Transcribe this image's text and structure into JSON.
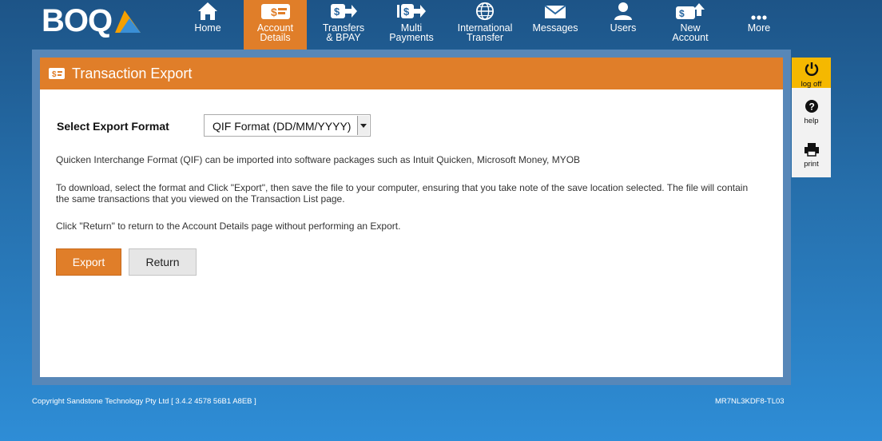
{
  "brand": {
    "logo_text": "BOQ"
  },
  "nav": {
    "items": [
      {
        "line1": "Home",
        "line2": "",
        "icon": "home-icon"
      },
      {
        "line1": "Account",
        "line2": "Details",
        "icon": "account-details-icon",
        "active": true
      },
      {
        "line1": "Transfers",
        "line2": "& BPAY",
        "icon": "transfers-icon"
      },
      {
        "line1": "Multi",
        "line2": "Payments",
        "icon": "multi-payments-icon"
      },
      {
        "line1": "International",
        "line2": "Transfer",
        "icon": "globe-icon"
      },
      {
        "line1": "Messages",
        "line2": "",
        "icon": "envelope-icon"
      },
      {
        "line1": "Users",
        "line2": "",
        "icon": "user-icon"
      },
      {
        "line1": "New",
        "line2": "Account",
        "icon": "new-account-icon"
      },
      {
        "line1": "More",
        "line2": "",
        "icon": "more-dots-icon"
      }
    ]
  },
  "panel": {
    "title": "Transaction Export",
    "format_label": "Select Export Format",
    "format_value": "QIF Format (DD/MM/YYYY)",
    "description": "Quicken Interchange Format (QIF) can be imported into software packages such as Intuit Quicken, Microsoft Money, MYOB",
    "instructions_line1": "To download, select the format and Click \"Export\", then save the file to your computer, ensuring that you take note of the save location selected. The file will contain",
    "instructions_line2": "the same transactions that you viewed on the Transaction List page.",
    "return_note": "Click \"Return\" to return to the Account Details page without performing an Export.",
    "export_label": "Export",
    "return_label": "Return"
  },
  "tools": {
    "logoff_label": "log off",
    "help_label": "help",
    "print_label": "print"
  },
  "footer": {
    "copyright": "Copyright Sandstone Technology Pty Ltd [ 3.4.2 4578 56B1 A8EB ]",
    "code": "MR7NL3KDF8-TL03"
  },
  "colors": {
    "accent_orange": "#e07e29",
    "logoff_yellow": "#f5b800",
    "panel_frame": "#5787b8",
    "background_top": "#1d5487",
    "background_bottom": "#2e8dd6"
  }
}
